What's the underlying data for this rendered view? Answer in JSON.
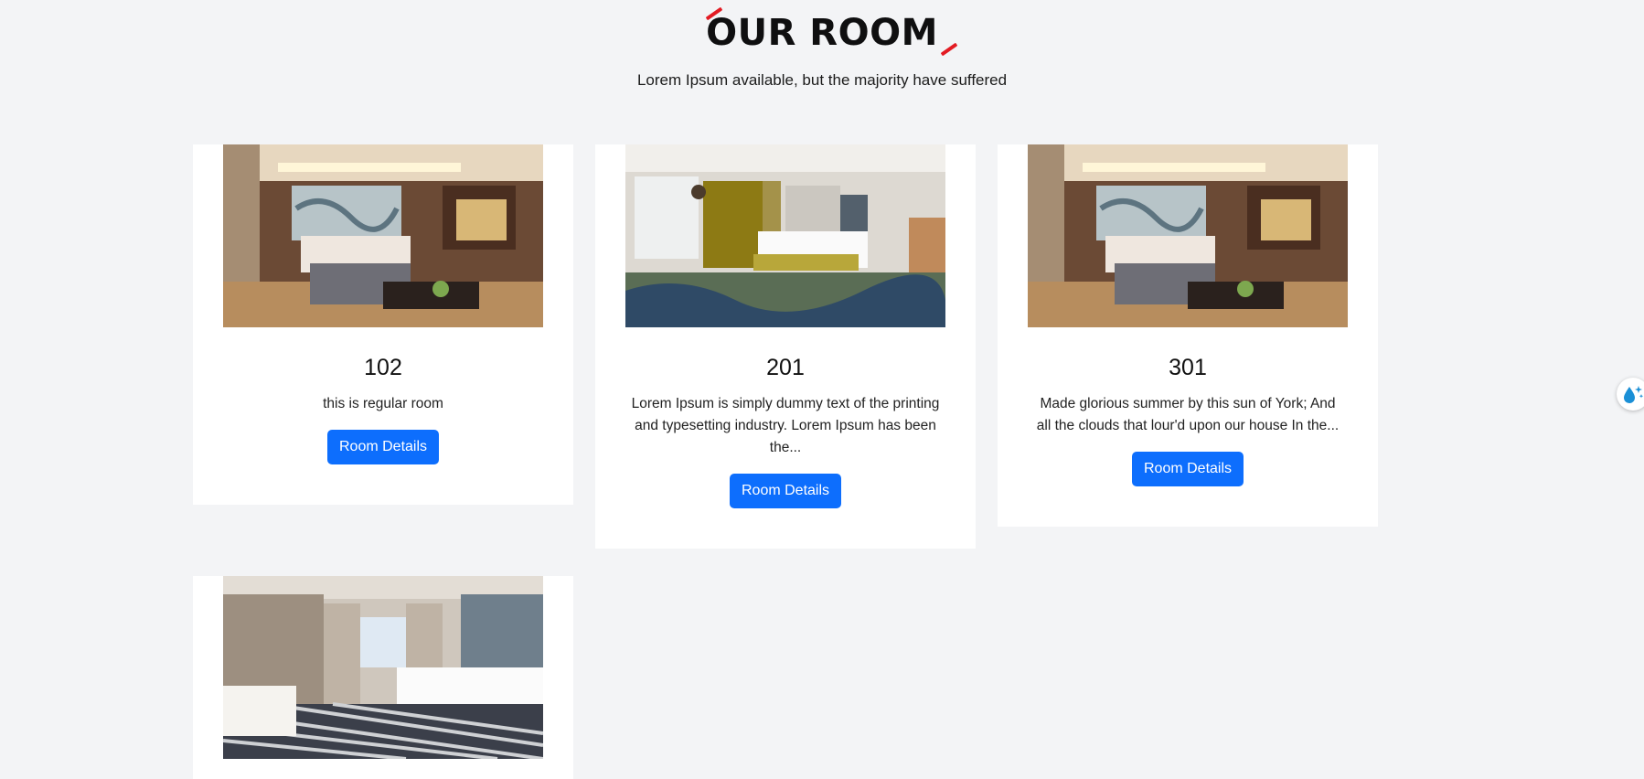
{
  "section": {
    "title": "OUR ROOM",
    "subtitle": "Lorem Ipsum available, but the majority have suffered"
  },
  "rooms": [
    {
      "number": "102",
      "description": "this is regular room",
      "button_label": "Room Details",
      "image": "hotel-suite-photo"
    },
    {
      "number": "201",
      "description": "Lorem Ipsum is simply dummy text of the printing and typesetting industry. Lorem Ipsum has been the...",
      "button_label": "Room Details",
      "image": "hotel-room-yellow-curtains-photo"
    },
    {
      "number": "301",
      "description": "Made glorious summer by this sun of York; And all the clouds that lour'd upon our house In the...",
      "button_label": "Room Details",
      "image": "hotel-suite-photo"
    },
    {
      "number": "",
      "description": "",
      "button_label": "",
      "image": "hotel-bedroom-striped-carpet-photo"
    }
  ],
  "colors": {
    "page_background": "#f3f4f6",
    "accent_red": "#e31b23",
    "button_blue": "#0d6efd"
  },
  "widgets": {
    "floating_icon": "water-drop-sparkle-icon"
  }
}
